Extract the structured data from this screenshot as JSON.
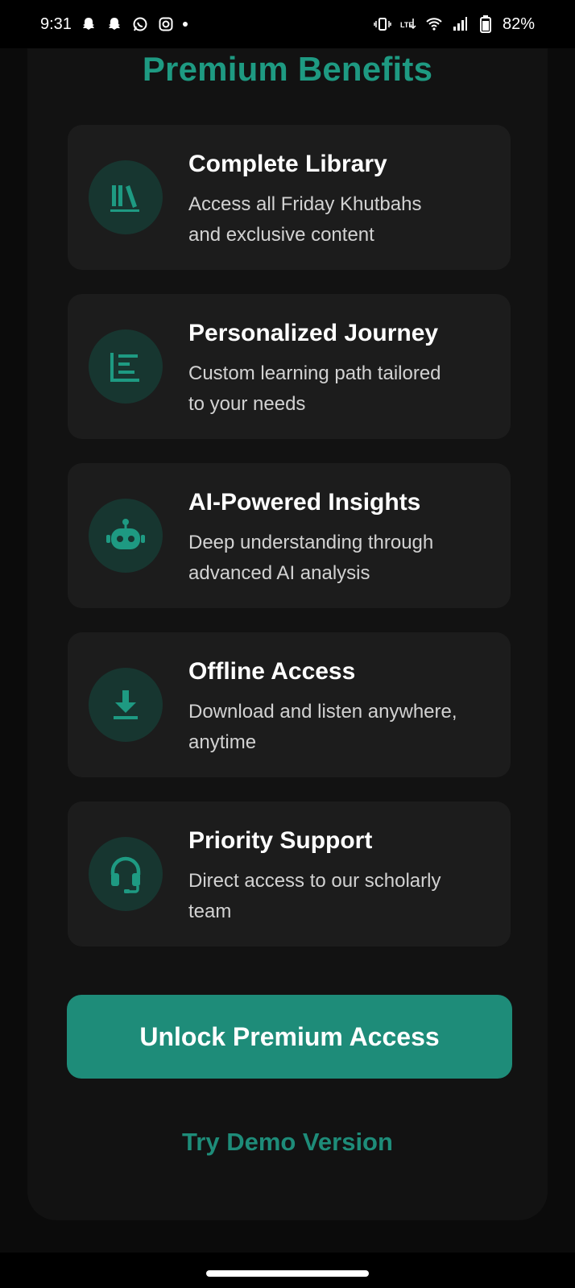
{
  "status_bar": {
    "time": "9:31",
    "battery": "82%",
    "left_icons": [
      "snapchat-icon",
      "snapchat-icon",
      "whatsapp-icon",
      "instagram-icon"
    ],
    "right_icons": [
      "vibrate-icon",
      "lte-icon",
      "wifi-icon",
      "signal-icon",
      "battery-icon"
    ]
  },
  "page": {
    "title": "Premium Benefits"
  },
  "benefits": [
    {
      "icon": "library-icon",
      "title": "Complete Library",
      "desc_line1": "Access all Friday Khutbahs",
      "desc_line2": "and exclusive content"
    },
    {
      "icon": "list-icon",
      "title": "Personalized Journey",
      "desc_line1": "Custom learning path tailored",
      "desc_line2": "to your needs"
    },
    {
      "icon": "robot-icon",
      "title": "AI-Powered Insights",
      "desc_line1": "Deep understanding through",
      "desc_line2": "advanced AI analysis"
    },
    {
      "icon": "download-icon",
      "title": "Offline Access",
      "desc_line1": "Download and listen anywhere,",
      "desc_line2": "anytime"
    },
    {
      "icon": "headset-icon",
      "title": "Priority Support",
      "desc_line1": "Direct access to our scholarly",
      "desc_line2": "team"
    }
  ],
  "actions": {
    "unlock_label": "Unlock Premium Access",
    "demo_label": "Try Demo Version"
  },
  "colors": {
    "accent": "#1e9a82",
    "button": "#1e8c79",
    "card": "#1c1c1c",
    "icon_circle": "#173630"
  }
}
